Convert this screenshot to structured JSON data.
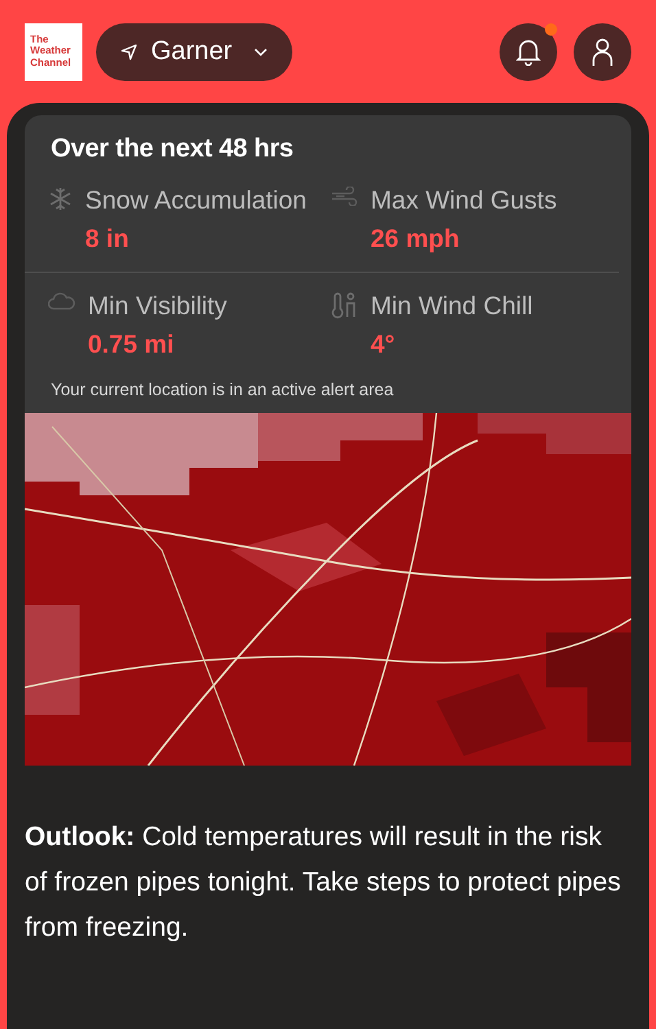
{
  "header": {
    "logo_lines": [
      "The",
      "Weather",
      "Channel"
    ],
    "location": "Garner",
    "notifications": {
      "unread": true
    }
  },
  "summary": {
    "title": "Over the next 48 hrs",
    "metrics": [
      {
        "kind": "snow",
        "label": "Snow Accumulation",
        "value": "8 in"
      },
      {
        "kind": "wind",
        "label": "Max Wind Gusts",
        "value": "26 mph"
      },
      {
        "kind": "visibility",
        "label": "Min Visibility",
        "value": "0.75 mi"
      },
      {
        "kind": "chill",
        "label": "Min Wind Chill",
        "value": "4°"
      }
    ],
    "note": "Your current location is in an active alert area"
  },
  "outlook": "**Outlook:** Cold temperatures will result in the risk of frozen pipes tonight. Take steps to protect pipes from freezing."
}
